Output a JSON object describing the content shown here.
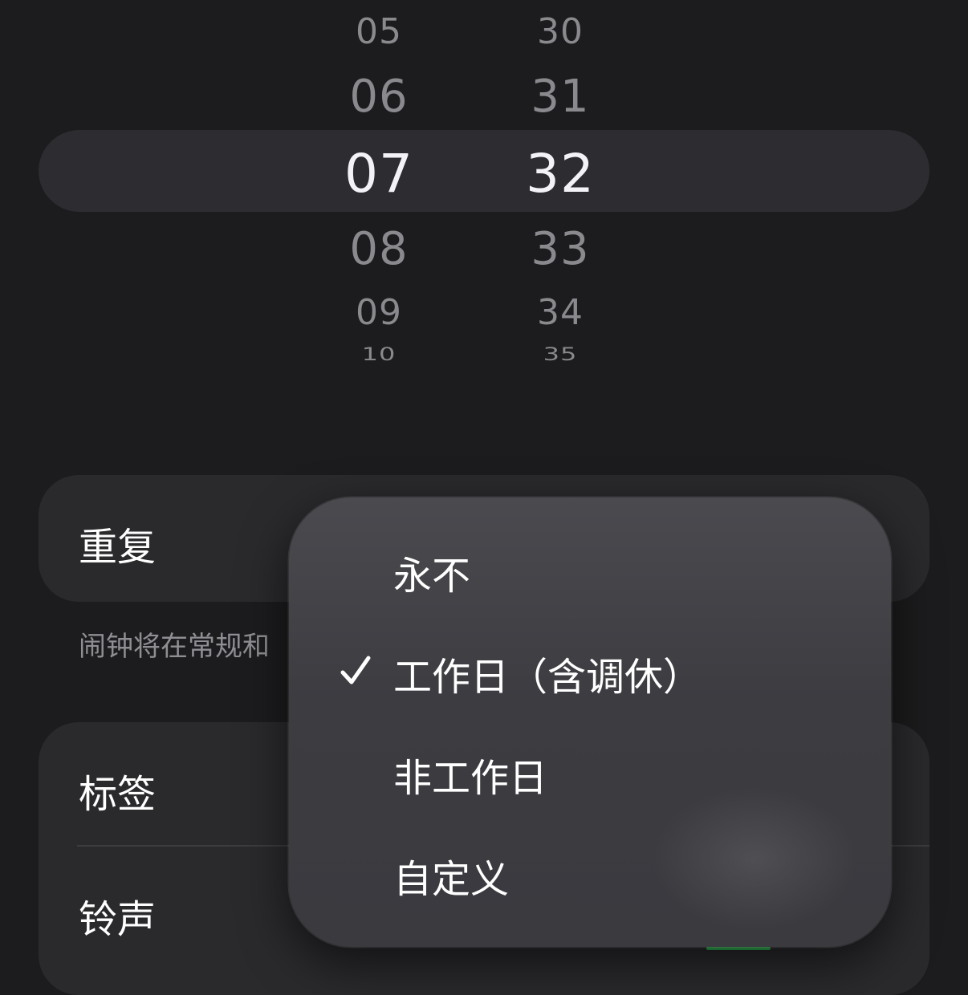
{
  "time_picker": {
    "hours": [
      {
        "value": "05",
        "state": "near"
      },
      {
        "value": "06",
        "state": "near"
      },
      {
        "value": "07",
        "state": "selected"
      },
      {
        "value": "08",
        "state": "near"
      },
      {
        "value": "09",
        "state": "near"
      },
      {
        "value": "10",
        "state": "far"
      }
    ],
    "minutes": [
      {
        "value": "30",
        "state": "near"
      },
      {
        "value": "31",
        "state": "near"
      },
      {
        "value": "32",
        "state": "selected"
      },
      {
        "value": "33",
        "state": "near"
      },
      {
        "value": "34",
        "state": "near"
      },
      {
        "value": "35",
        "state": "far"
      }
    ]
  },
  "settings": {
    "repeat_label": "重复",
    "hint_text": "闹钟将在常规和",
    "label_label": "标签",
    "ringtone_label": "铃声"
  },
  "repeat_menu": {
    "items": [
      {
        "label": "永不",
        "checked": false
      },
      {
        "label": "工作日（含调休）",
        "checked": true
      },
      {
        "label": "非工作日",
        "checked": false
      },
      {
        "label": "自定义",
        "checked": false
      }
    ]
  },
  "colors": {
    "background": "#1c1c1e",
    "card": "#2a2a2d",
    "menu": "#3f3f44",
    "accent_green": "#30d158"
  }
}
